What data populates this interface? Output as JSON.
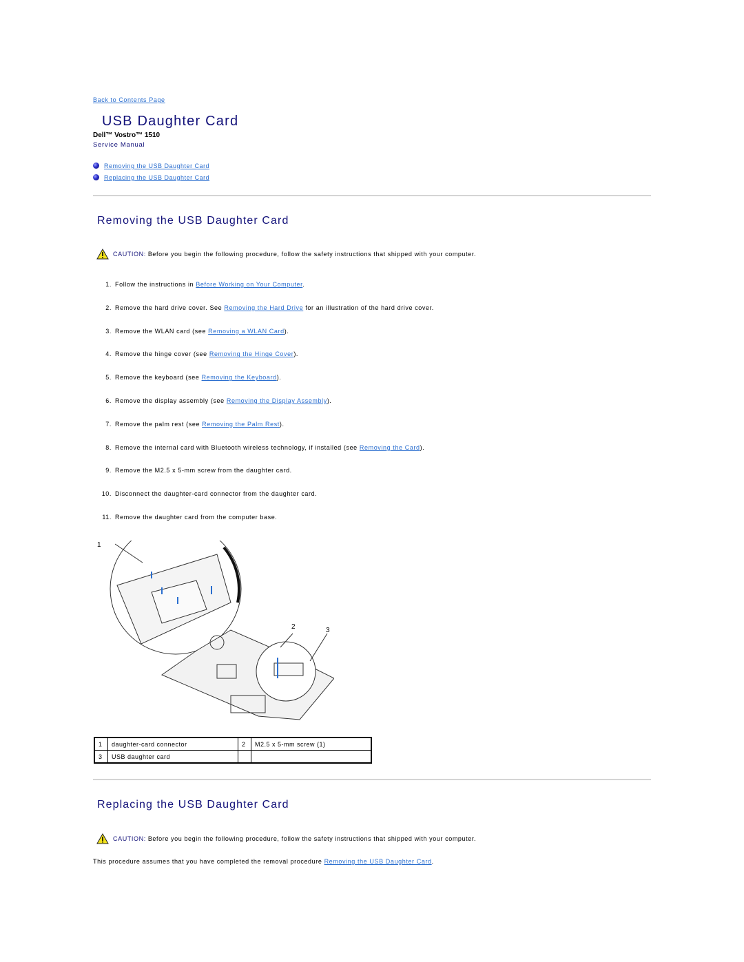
{
  "nav": {
    "back_link": "Back to Contents Page"
  },
  "header": {
    "title": "USB Daughter Card",
    "product": "Dell™ Vostro™ 1510",
    "manual": "Service Manual"
  },
  "toc": [
    {
      "label": "Removing the USB Daughter Card",
      "icon": "bullet-icon"
    },
    {
      "label": "Replacing the USB Daughter Card",
      "icon": "bullet-icon"
    }
  ],
  "removing": {
    "heading": "Removing the USB Daughter Card",
    "caution": {
      "icon": "warning-triangle-icon",
      "label": "CAUTION:",
      "text": "Before you begin the following procedure, follow the safety instructions that shipped with your computer."
    },
    "steps": [
      {
        "num": "1.",
        "pre": "Follow the instructions in ",
        "link": "Before Working on Your Computer",
        "post": "."
      },
      {
        "num": "2.",
        "pre": "Remove the hard drive cover. See ",
        "link": "Removing the Hard Drive",
        "post": " for an illustration of the hard drive cover."
      },
      {
        "num": "3.",
        "pre": "Remove the WLAN card (see ",
        "link": "Removing a WLAN Card",
        "post": ")."
      },
      {
        "num": "4.",
        "pre": "Remove the hinge cover (see ",
        "link": "Removing the Hinge Cover",
        "post": ")."
      },
      {
        "num": "5.",
        "pre": "Remove the keyboard (see ",
        "link": "Removing the Keyboard",
        "post": ")."
      },
      {
        "num": "6.",
        "pre": "Remove the display assembly (see ",
        "link": "Removing the Display Assembly",
        "post": ")."
      },
      {
        "num": "7.",
        "pre": "Remove the palm rest (see ",
        "link": "Removing the Palm Rest",
        "post": ")."
      },
      {
        "num": "8.",
        "pre": "Remove the internal card with Bluetooth wireless technology, if installed (see ",
        "link": "Removing the Card",
        "post": ")."
      },
      {
        "num": "9.",
        "pre": "Remove the M2.5 x 5-mm screw from the daughter card.",
        "link": "",
        "post": ""
      },
      {
        "num": "10.",
        "pre": "Disconnect the daughter-card connector from the daughter card.",
        "link": "",
        "post": ""
      },
      {
        "num": "11.",
        "pre": "Remove the daughter card from the computer base.",
        "link": "",
        "post": ""
      }
    ],
    "figure": {
      "callouts": [
        "1",
        "2",
        "3"
      ]
    },
    "legend": [
      [
        {
          "num": "1",
          "label": "daughter-card connector"
        },
        {
          "num": "2",
          "label": "M2.5 x 5-mm screw (1)"
        }
      ],
      [
        {
          "num": "3",
          "label": "USB daughter card"
        },
        {
          "num": "",
          "label": ""
        }
      ]
    ]
  },
  "replacing": {
    "heading": "Replacing the USB Daughter Card",
    "caution": {
      "icon": "warning-triangle-icon",
      "label": "CAUTION:",
      "text": "Before you begin the following procedure, follow the safety instructions that shipped with your computer."
    },
    "assume_pre": "This procedure assumes that you have completed the removal procedure ",
    "assume_link": "Removing the USB Daughter Card",
    "assume_post": "."
  }
}
